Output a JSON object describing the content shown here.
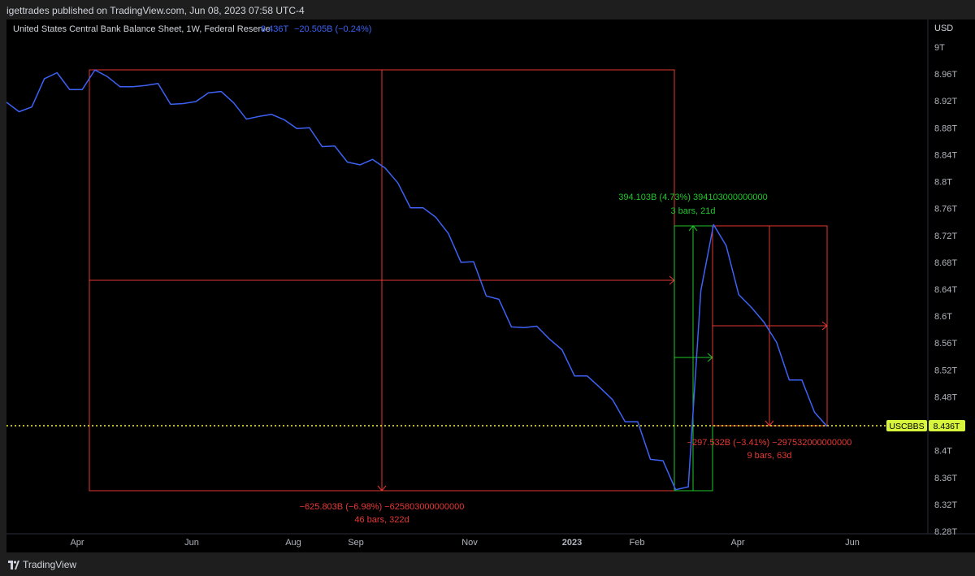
{
  "header": {
    "published_line": "igettrades published on TradingView.com, Jun 08, 2023 07:58 UTC-4"
  },
  "legend": {
    "title": "United States Central Bank Balance Sheet, 1W, Federal Reserve",
    "last_value": "8.436T",
    "change": "−20.505B (−0.24%)"
  },
  "axis": {
    "currency": "USD",
    "price_ticks": [
      "9T",
      "8.96T",
      "8.92T",
      "8.88T",
      "8.84T",
      "8.8T",
      "8.76T",
      "8.72T",
      "8.68T",
      "8.64T",
      "8.6T",
      "8.56T",
      "8.52T",
      "8.48T",
      "8.44T",
      "8.4T",
      "8.36T",
      "8.32T",
      "8.28T"
    ],
    "time_ticks": [
      "Apr",
      "Jun",
      "Aug",
      "Sep",
      "Nov",
      "2023",
      "Feb",
      "Apr",
      "Jun"
    ],
    "time_tick_bold": "2023",
    "symbol_tag": "USCBBS",
    "price_tag": "8.436T"
  },
  "measurements": {
    "m1": {
      "line1": "−625.803B (−6.98%) −625803000000000",
      "line2": "46 bars, 322d"
    },
    "m2": {
      "line1": "394.103B (4.73%) 394103000000000",
      "line2": "3 bars, 21d"
    },
    "m3": {
      "line1": "−297.532B (−3.41%) −297532000000000",
      "line2": "9 bars, 63d"
    }
  },
  "footer": {
    "brand": "TradingView"
  },
  "colors": {
    "background": "#000000",
    "series": "#3d62f5",
    "down_measure": "#e53935",
    "up_measure": "#22c62c",
    "price_line": "#f5f534",
    "tag_bg": "#d7f53c"
  },
  "chart_data": {
    "type": "line",
    "title": "United States Central Bank Balance Sheet, 1W, Federal Reserve",
    "unit": "USD",
    "ylim": [
      8.28,
      9.0
    ],
    "grid": false,
    "x_ticks": [
      "Apr",
      "Jun",
      "Aug",
      "Sep",
      "Nov",
      "2023",
      "Feb",
      "Apr",
      "Jun"
    ],
    "series": [
      {
        "values": [
          8.918,
          8.904,
          8.911,
          8.953,
          8.962,
          8.937,
          8.937,
          8.966,
          8.956,
          8.941,
          8.941,
          8.943,
          8.946,
          8.915,
          8.916,
          8.919,
          8.932,
          8.934,
          8.917,
          8.893,
          8.897,
          8.9,
          8.892,
          8.879,
          8.88,
          8.852,
          8.853,
          8.829,
          8.825,
          8.833,
          8.82,
          8.798,
          8.761,
          8.761,
          8.747,
          8.723,
          8.68,
          8.681,
          8.63,
          8.625,
          8.584,
          8.583,
          8.585,
          8.566,
          8.55,
          8.511,
          8.511,
          8.494,
          8.476,
          8.443,
          8.443,
          8.387,
          8.385,
          8.342,
          8.346,
          8.638,
          8.736,
          8.705,
          8.632,
          8.613,
          8.591,
          8.561,
          8.505,
          8.505,
          8.457,
          8.436
        ]
      }
    ]
  }
}
